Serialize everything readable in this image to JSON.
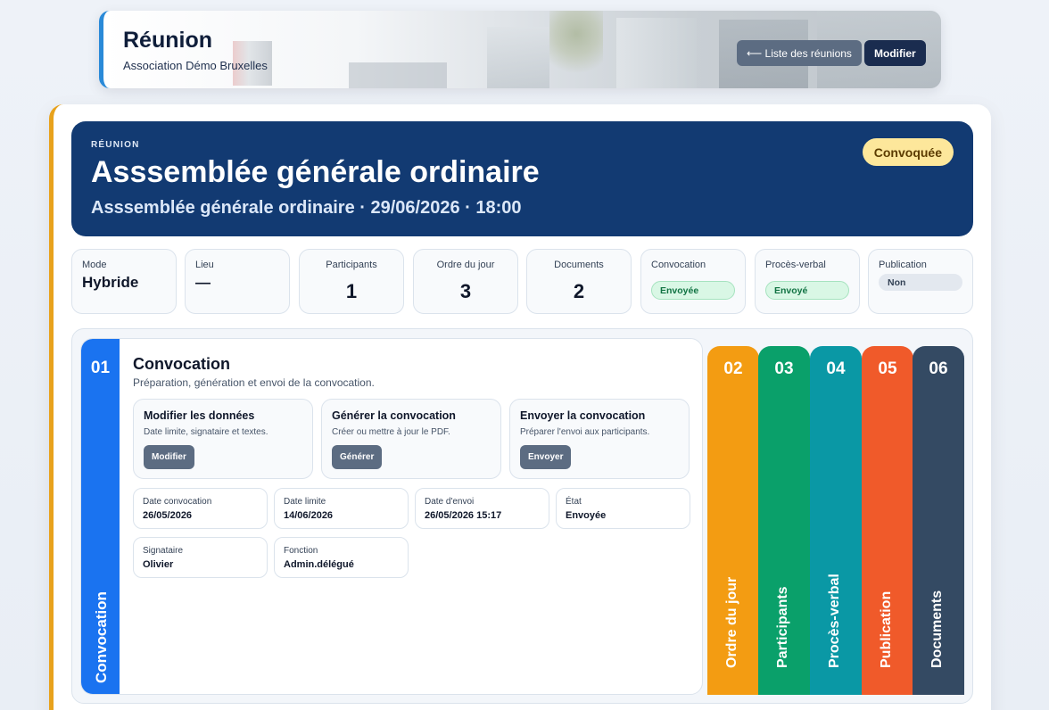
{
  "header": {
    "title": "Réunion",
    "subtitle": "Association Démo Bruxelles",
    "back_label": "⟵ Liste des réunions",
    "edit_label": "Modifier"
  },
  "banner": {
    "eyebrow": "RÉUNION",
    "title": "Asssemblée générale ordinaire",
    "subtitle": "Asssemblée générale ordinaire · 29/06/2026 · 18:00",
    "status": "Convoquée"
  },
  "stats": {
    "mode": {
      "label": "Mode",
      "value": "Hybride"
    },
    "lieu": {
      "label": "Lieu",
      "value": "—"
    },
    "participants": {
      "label": "Participants",
      "value": "1"
    },
    "ordre": {
      "label": "Ordre du jour",
      "value": "3"
    },
    "documents": {
      "label": "Documents",
      "value": "2"
    },
    "convocation": {
      "label": "Convocation",
      "value": "Envoyée"
    },
    "pv": {
      "label": "Procès-verbal",
      "value": "Envoyé"
    },
    "publication": {
      "label": "Publication",
      "value": "Non"
    }
  },
  "active_step": {
    "number": "01",
    "label": "Convocation",
    "title": "Convocation",
    "description": "Préparation, génération et envoi de la convocation.",
    "actions": [
      {
        "title": "Modifier les données",
        "desc": "Date limite, signataire et textes.",
        "button": "Modifier"
      },
      {
        "title": "Générer la convocation",
        "desc": "Créer ou mettre à jour le PDF.",
        "button": "Générer"
      },
      {
        "title": "Envoyer la convocation",
        "desc": "Préparer l'envoi aux participants.",
        "button": "Envoyer"
      }
    ],
    "fields": [
      {
        "label": "Date convocation",
        "value": "26/05/2026"
      },
      {
        "label": "Date limite",
        "value": "14/06/2026"
      },
      {
        "label": "Date d'envoi",
        "value": "26/05/2026 15:17"
      },
      {
        "label": "État",
        "value": "Envoyée"
      },
      {
        "label": "Signataire",
        "value": "Olivier"
      },
      {
        "label": "Fonction",
        "value": "Admin.délégué"
      }
    ]
  },
  "steps": [
    {
      "number": "02",
      "label": "Ordre du jour",
      "color": "#f39c12"
    },
    {
      "number": "03",
      "label": "Participants",
      "color": "#0aa06a"
    },
    {
      "number": "04",
      "label": "Procès-verbal",
      "color": "#0a98a5"
    },
    {
      "number": "05",
      "label": "Publication",
      "color": "#f05a2a"
    },
    {
      "number": "06",
      "label": "Documents",
      "color": "#344a63"
    }
  ],
  "colors": {
    "banner": "#123a72",
    "active_rail": "#1a73f0",
    "accent_left": "#e8a21c"
  }
}
